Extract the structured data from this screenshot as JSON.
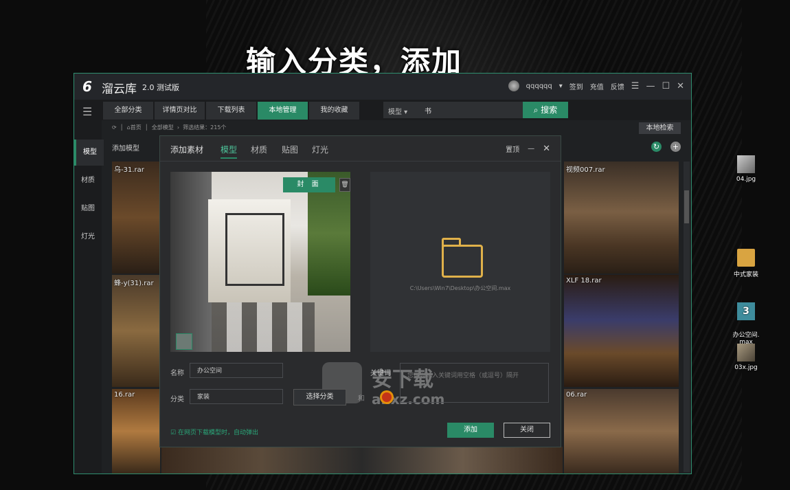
{
  "caption": "输入分类，添加",
  "app": {
    "name": "溜云库",
    "version": "2.0 测试版",
    "user": "qqqqqq",
    "links": [
      "签到",
      "充值",
      "反馈"
    ]
  },
  "nav": {
    "tabs": [
      "全部分类",
      "详情页对比",
      "下载列表",
      "本地管理",
      "我的收藏"
    ],
    "active_tab": "本地管理",
    "search_type": "模型",
    "search_text": "书",
    "search_button": "搜索"
  },
  "sidebar": [
    "模型",
    "材质",
    "贴图",
    "灯光"
  ],
  "breadcrumb": {
    "home": "首页",
    "all": "全部模型",
    "result": "筛选结果：215个"
  },
  "local_search": "本地检索",
  "add_model_label": "添加模型",
  "thumbnails": [
    {
      "label": "乌-31.rar"
    },
    {
      "label": "蜂-y(31).rar"
    },
    {
      "label": "16.rar"
    },
    {
      "label": "视频007.rar"
    },
    {
      "label": "XLF 18.rar"
    },
    {
      "label": "06.rar"
    }
  ],
  "dialog": {
    "title": "添加素材",
    "tabs": [
      "模型",
      "材质",
      "贴图",
      "灯光"
    ],
    "active_tab": "模型",
    "pin": "置顶",
    "cover_button": "封 面",
    "file_path": "C:\\Users\\Win7\\Desktop\\办公空间.max",
    "name_label": "名称",
    "name_value": "办公空间",
    "category_label": "分类",
    "category_value": "家装",
    "select_category_button": "选择分类",
    "keyword_label": "关键词",
    "keyword_placeholder": "您可以输入关键词用空格（或逗号）隔开",
    "auto_popup": "在网页下载模型时，自动弹出",
    "add_button": "添加",
    "close_button": "关闭"
  },
  "watermark": {
    "title": "安下载",
    "domain": "anxz.com",
    "mark": "和"
  },
  "desktop_icons": [
    {
      "label": "04.jpg",
      "color": "#9a9a9a"
    },
    {
      "label": "中式家装",
      "color": "#d9a441"
    },
    {
      "label": "办公空间.\nmax",
      "color": "#3e8c9c"
    },
    {
      "label": "03x.jpg",
      "color": "#8a8070"
    }
  ],
  "colors": {
    "accent": "#2a8a66",
    "folder": "#e0b14a"
  }
}
